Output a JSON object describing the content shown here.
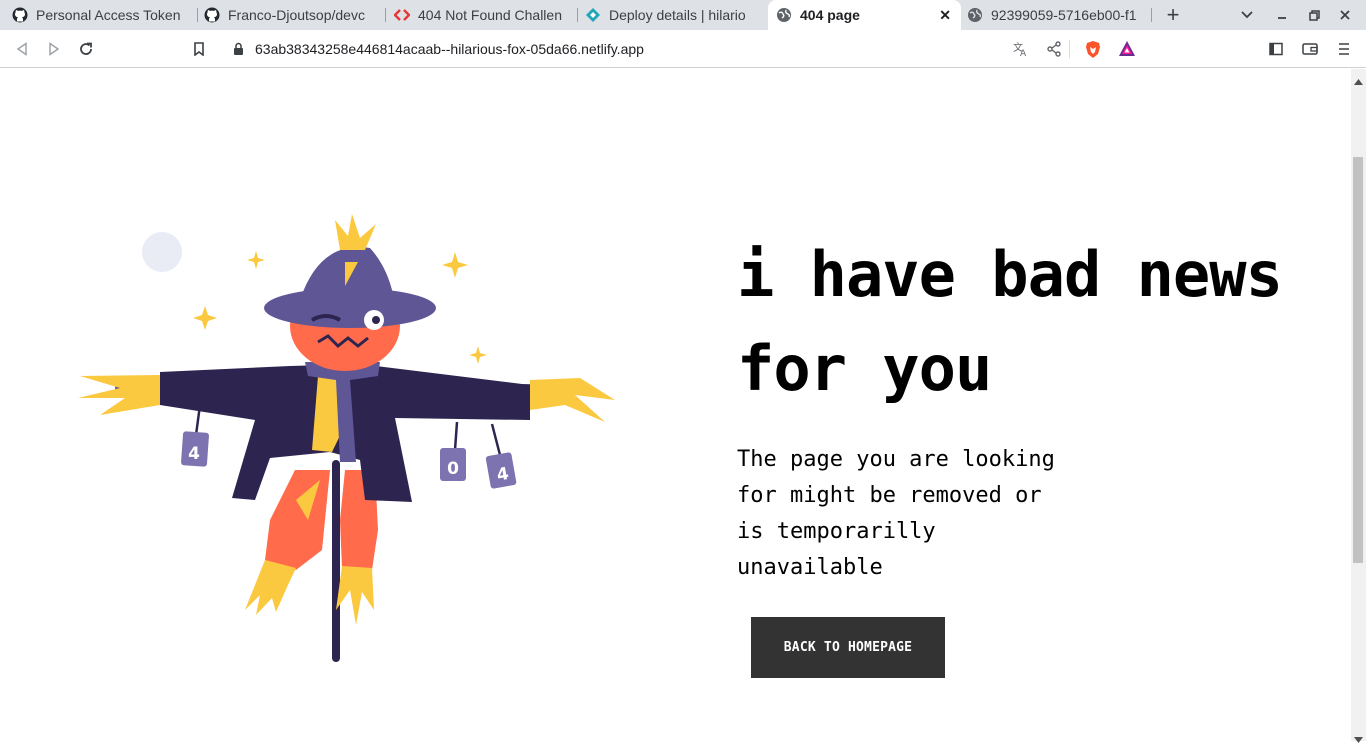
{
  "tabs": [
    {
      "title": "Personal Access Token",
      "icon": "github-icon"
    },
    {
      "title": "Franco-Djoutsop/devc",
      "icon": "github-icon"
    },
    {
      "title": "404 Not Found Challen",
      "icon": "frontend-mentor-icon"
    },
    {
      "title": "Deploy details | hilario",
      "icon": "netlify-icon"
    },
    {
      "title": "404 page",
      "icon": "globe-icon",
      "active": true
    },
    {
      "title": "92399059-5716eb00-f1",
      "icon": "globe-icon"
    }
  ],
  "address_bar": {
    "url": "63ab38343258e446814acaab--hilarious-fox-05da66.netlify.app"
  },
  "page": {
    "headline_line1": "i have bad news",
    "headline_line2": "for you",
    "description_lines": [
      "The page you are looking",
      "for might be removed or",
      "is temporarilly",
      "unavailable"
    ],
    "button_label": "BACK TO HOMEPAGE"
  },
  "illustration": {
    "can_labels": [
      "4",
      "0",
      "4"
    ]
  },
  "colors": {
    "tab_bar": "#dee1e6",
    "button": "#333333",
    "hat": "#5f5696",
    "face": "#ff6b4b",
    "coat": "#2d2550",
    "straw": "#fbc93f"
  }
}
